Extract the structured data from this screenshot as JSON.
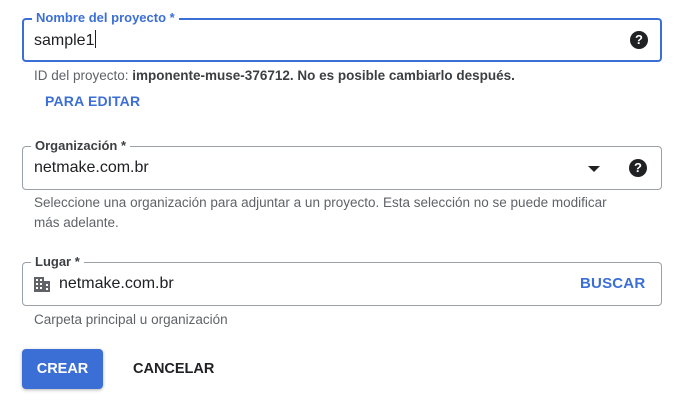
{
  "project_name": {
    "label": "Nombre del proyecto *",
    "value": "sample1",
    "help_icon": "help-circle-icon"
  },
  "project_id": {
    "prefix": "ID del proyecto: ",
    "id_value": "imponente-muse-376712",
    "suffix": ". No es posible cambiarlo después.",
    "edit_link": "PARA EDITAR"
  },
  "organization": {
    "label": "Organización *",
    "value": "netmake.com.br",
    "dropdown_icon": "caret-down-icon",
    "help_icon": "help-circle-icon",
    "hint": "Seleccione una organización para adjuntar a un proyecto. Esta selección no se puede modificar más adelante."
  },
  "location": {
    "label": "Lugar *",
    "icon": "building-icon",
    "value": "netmake.com.br",
    "browse_label": "BUSCAR",
    "hint": "Carpeta principal u organización"
  },
  "actions": {
    "create_label": "CREAR",
    "cancel_label": "CANCELAR"
  },
  "colors": {
    "accent": "#3c6fd6",
    "border": "#9aa0a6",
    "text": "#202124",
    "hint": "#5f6368"
  }
}
